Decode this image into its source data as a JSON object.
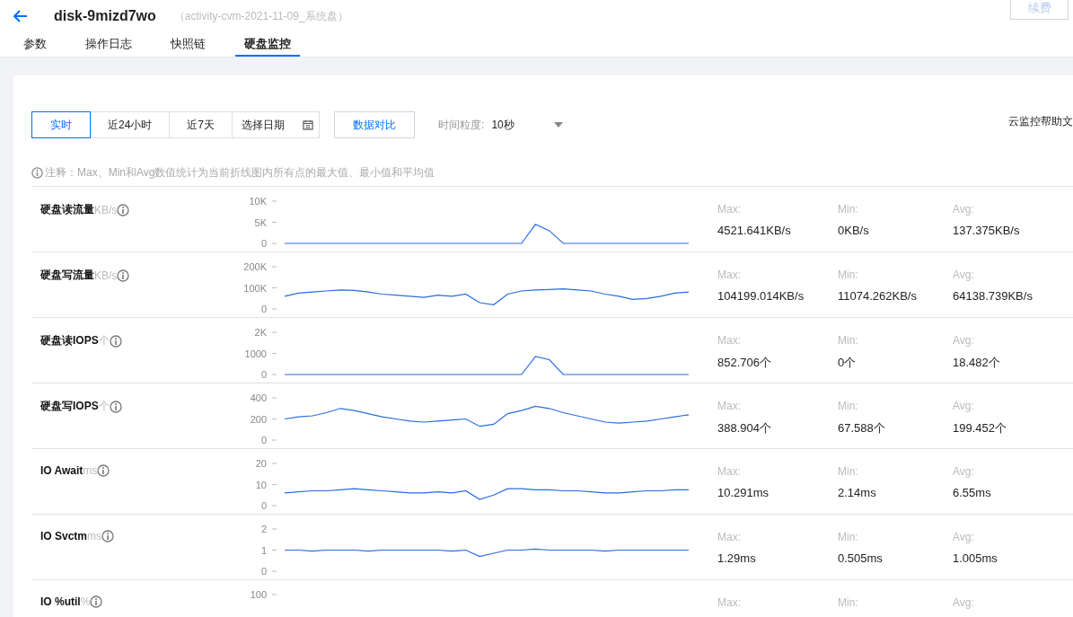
{
  "header": {
    "title": "disk-9mizd7wo",
    "subtitle": "（activity-cvm-2021-11-09_系统盘）",
    "renew_button": "续费"
  },
  "tabs": [
    {
      "label": "参数",
      "selected": false
    },
    {
      "label": "操作日志",
      "selected": false
    },
    {
      "label": "快照链",
      "selected": false
    },
    {
      "label": "硬盘监控",
      "selected": true
    }
  ],
  "toolbar": {
    "ranges": [
      {
        "label": "实时",
        "selected": true
      },
      {
        "label": "近24小时",
        "selected": false
      },
      {
        "label": "近7天",
        "selected": false
      },
      {
        "label": "选择日期",
        "selected": false,
        "kind": "date"
      }
    ],
    "compare_button": "数据对比",
    "granularity_label": "时间粒度:",
    "granularity_value": "10秒",
    "help_link": "云监控帮助文"
  },
  "note": "注释：Max、Min和Avg数值统计为当前折线图内所有点的最大值、最小值和平均值",
  "metrics": [
    {
      "name": "硬盘读流量",
      "unit": "KB/s",
      "stats": [
        {
          "label": "Max:",
          "value": "4521.641KB/s"
        },
        {
          "label": "Min:",
          "value": "0KB/s"
        },
        {
          "label": "Avg:",
          "value": "137.375KB/s"
        }
      ],
      "chart_data": {
        "type": "line",
        "ylim": [
          0,
          10000
        ],
        "yticks": [
          {
            "value": 0,
            "label": "0"
          },
          {
            "value": 5000,
            "label": "5K"
          },
          {
            "value": 10000,
            "label": "10K"
          }
        ],
        "series": [
          {
            "color": "#2a6ce0",
            "values": [
              0,
              0,
              0,
              0,
              0,
              0,
              0,
              0,
              0,
              0,
              0,
              0,
              0,
              0,
              0,
              0,
              0,
              0,
              4500,
              3000,
              0,
              0,
              0,
              0,
              0,
              0,
              0,
              0,
              0,
              0
            ]
          }
        ]
      }
    },
    {
      "name": "硬盘写流量",
      "unit": "KB/s",
      "stats": [
        {
          "label": "Max:",
          "value": "104199.014KB/s"
        },
        {
          "label": "Min:",
          "value": "11074.262KB/s"
        },
        {
          "label": "Avg:",
          "value": "64138.739KB/s"
        }
      ],
      "chart_data": {
        "type": "line",
        "ylim": [
          0,
          200000
        ],
        "yticks": [
          {
            "value": 0,
            "label": "0"
          },
          {
            "value": 100000,
            "label": "100K"
          },
          {
            "value": 200000,
            "label": "200K"
          }
        ],
        "series": [
          {
            "color": "#2a6ce0",
            "values": [
              60000,
              75000,
              80000,
              85000,
              90000,
              88000,
              80000,
              70000,
              65000,
              60000,
              55000,
              65000,
              60000,
              70000,
              30000,
              20000,
              70000,
              85000,
              90000,
              92000,
              95000,
              90000,
              85000,
              70000,
              60000,
              45000,
              50000,
              60000,
              75000,
              80000
            ]
          }
        ]
      }
    },
    {
      "name": "硬盘读IOPS",
      "unit": "个",
      "stats": [
        {
          "label": "Max:",
          "value": "852.706个"
        },
        {
          "label": "Min:",
          "value": "0个"
        },
        {
          "label": "Avg:",
          "value": "18.482个"
        }
      ],
      "chart_data": {
        "type": "line",
        "ylim": [
          0,
          2000
        ],
        "yticks": [
          {
            "value": 0,
            "label": "0"
          },
          {
            "value": 1000,
            "label": "1000"
          },
          {
            "value": 2000,
            "label": "2K"
          }
        ],
        "series": [
          {
            "color": "#2a6ce0",
            "values": [
              0,
              0,
              0,
              0,
              0,
              0,
              0,
              0,
              0,
              0,
              0,
              0,
              0,
              0,
              0,
              0,
              0,
              0,
              850,
              700,
              0,
              0,
              0,
              0,
              0,
              0,
              0,
              0,
              0,
              0
            ]
          }
        ]
      }
    },
    {
      "name": "硬盘写IOPS",
      "unit": "个",
      "stats": [
        {
          "label": "Max:",
          "value": "388.904个"
        },
        {
          "label": "Min:",
          "value": "67.588个"
        },
        {
          "label": "Avg:",
          "value": "199.452个"
        }
      ],
      "chart_data": {
        "type": "line",
        "ylim": [
          0,
          400
        ],
        "yticks": [
          0,
          200,
          400
        ],
        "series": [
          {
            "color": "#2a6ce0",
            "values": [
              200,
              220,
              230,
              260,
              300,
              280,
              250,
              220,
              200,
              180,
              170,
              180,
              190,
              200,
              130,
              150,
              250,
              280,
              320,
              300,
              260,
              230,
              200,
              170,
              160,
              170,
              180,
              200,
              220,
              240
            ]
          }
        ]
      }
    },
    {
      "name": "IO Await",
      "unit": "ms",
      "stats": [
        {
          "label": "Max:",
          "value": "10.291ms"
        },
        {
          "label": "Min:",
          "value": "2.14ms"
        },
        {
          "label": "Avg:",
          "value": "6.55ms"
        }
      ],
      "chart_data": {
        "type": "line",
        "ylim": [
          0,
          20
        ],
        "yticks": [
          0,
          10,
          20
        ],
        "series": [
          {
            "color": "#2a6ce0",
            "values": [
              6,
              6.5,
              7,
              7,
              7.5,
              8,
              7.5,
              7,
              6.5,
              6,
              6,
              6.5,
              6,
              7,
              3,
              5,
              8,
              8,
              7.5,
              7.5,
              7,
              7,
              6.5,
              6,
              6,
              6.5,
              7,
              7,
              7.5,
              7.5
            ]
          }
        ]
      }
    },
    {
      "name": "IO Svctm",
      "unit": "ms",
      "stats": [
        {
          "label": "Max:",
          "value": "1.29ms"
        },
        {
          "label": "Min:",
          "value": "0.505ms"
        },
        {
          "label": "Avg:",
          "value": "1.005ms"
        }
      ],
      "chart_data": {
        "type": "line",
        "ylim": [
          0,
          2
        ],
        "yticks": [
          0,
          1,
          2
        ],
        "series": [
          {
            "color": "#2a6ce0",
            "values": [
              1,
              1,
              0.95,
              1,
              1,
              1,
              0.95,
              1,
              1,
              1,
              1,
              1,
              0.95,
              1,
              0.7,
              0.85,
              1,
              1,
              1.05,
              1,
              1,
              1,
              1,
              0.95,
              1,
              1,
              1,
              1,
              1,
              1
            ]
          }
        ]
      }
    },
    {
      "name": "IO %util",
      "unit": "%",
      "stats": [
        {
          "label": "Max:"
        },
        {
          "label": "Min:"
        },
        {
          "label": "Avg:"
        }
      ],
      "axis_label": "100"
    }
  ]
}
